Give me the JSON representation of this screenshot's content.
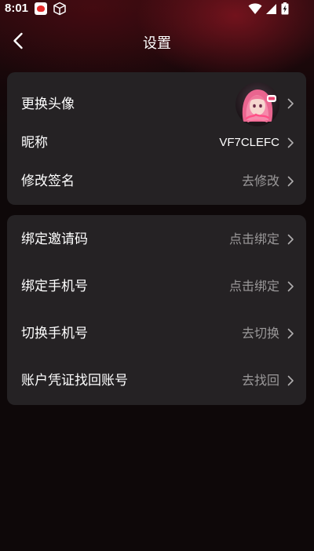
{
  "status_bar": {
    "time": "8:01"
  },
  "header": {
    "title": "设置"
  },
  "profile_section": {
    "items": [
      {
        "label": "更换头像",
        "value": ""
      },
      {
        "label": "昵称",
        "value": "VF7CLEFC"
      },
      {
        "label": "修改签名",
        "value": "去修改"
      }
    ]
  },
  "account_section": {
    "items": [
      {
        "label": "绑定邀请码",
        "value": "点击绑定"
      },
      {
        "label": "绑定手机号",
        "value": "点击绑定"
      },
      {
        "label": "切换手机号",
        "value": "去切换"
      },
      {
        "label": "账户凭证找回账号",
        "value": "去找回"
      }
    ]
  },
  "colors": {
    "background": "#0e0809",
    "card": "#252224",
    "secondary_text": "#9a9899",
    "accent_glow": "#8c1622"
  },
  "icons": {
    "back": "chevron-left-icon",
    "row_arrow": "chevron-right-icon",
    "wifi": "wifi-icon",
    "signal": "signal-icon",
    "battery": "battery-charging-icon"
  }
}
